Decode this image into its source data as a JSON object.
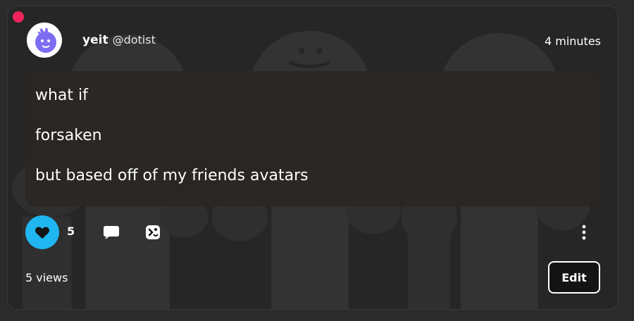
{
  "post": {
    "author_name": "yeit",
    "author_handle": "@dotist",
    "timestamp": "4 minutes",
    "lines": [
      "what if",
      "forsaken",
      "but based off of my friends avatars"
    ],
    "like_count": "5",
    "views_label": "5 views",
    "edit_label": "Edit"
  },
  "icons": {
    "avatar": "avatar-drawing-icon",
    "like": "heart-icon",
    "comment": "speech-bubble-icon",
    "remix": "remix-icon",
    "more": "vertical-dots-icon"
  },
  "colors": {
    "notification_dot": "#f0245c",
    "like_active": "#1fb6f2",
    "avatar_accent": "#7c6cf2",
    "post_text": "#ffffff"
  }
}
